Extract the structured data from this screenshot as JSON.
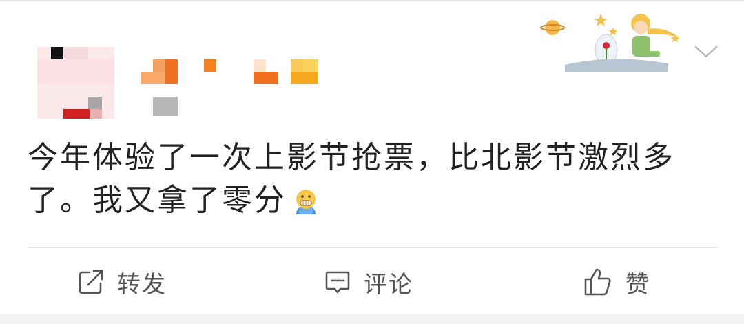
{
  "post": {
    "text_line1": "今年体验了一次上影节抢票，比北影节激烈多",
    "text_line2": "了。我又拿了零分",
    "emoji_icon": "grimacing-face-icon"
  },
  "actions": {
    "repost_label": "转发",
    "comment_label": "评论",
    "like_label": "赞"
  },
  "icons": {
    "repost": "share-arrow-icon",
    "comment": "comment-bubble-icon",
    "like": "thumbs-up-icon",
    "menu": "chevron-down-icon"
  },
  "colors": {
    "text": "#222222",
    "action_text": "#555555",
    "divider": "#e6e6e6",
    "username_orange": "#f07020"
  }
}
